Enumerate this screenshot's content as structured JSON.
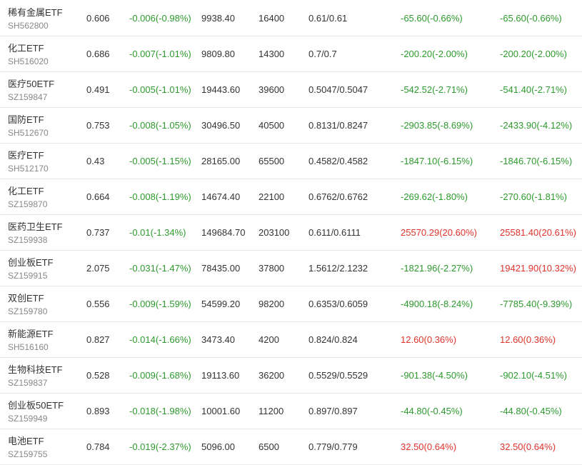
{
  "colors": {
    "down": "#2d9a2d",
    "up": "#e0332b",
    "text": "#333333",
    "code": "#888888",
    "divider": "#e8e8e8"
  },
  "rows": [
    {
      "name": "稀有金属ETF",
      "code": "SH562800",
      "price": "0.606",
      "change": "-0.006(-0.98%)",
      "change_dir": "down",
      "turnover": "9938.40",
      "volume": "16400",
      "range": "0.61/0.61",
      "flow1": "-65.60(-0.66%)",
      "flow1_dir": "down",
      "flow2": "-65.60(-0.66%)",
      "flow2_dir": "down"
    },
    {
      "name": "化工ETF",
      "code": "SH516020",
      "price": "0.686",
      "change": "-0.007(-1.01%)",
      "change_dir": "down",
      "turnover": "9809.80",
      "volume": "14300",
      "range": "0.7/0.7",
      "flow1": "-200.20(-2.00%)",
      "flow1_dir": "down",
      "flow2": "-200.20(-2.00%)",
      "flow2_dir": "down"
    },
    {
      "name": "医疗50ETF",
      "code": "SZ159847",
      "price": "0.491",
      "change": "-0.005(-1.01%)",
      "change_dir": "down",
      "turnover": "19443.60",
      "volume": "39600",
      "range": "0.5047/0.5047",
      "flow1": "-542.52(-2.71%)",
      "flow1_dir": "down",
      "flow2": "-541.40(-2.71%)",
      "flow2_dir": "down"
    },
    {
      "name": "国防ETF",
      "code": "SH512670",
      "price": "0.753",
      "change": "-0.008(-1.05%)",
      "change_dir": "down",
      "turnover": "30496.50",
      "volume": "40500",
      "range": "0.8131/0.8247",
      "flow1": "-2903.85(-8.69%)",
      "flow1_dir": "down",
      "flow2": "-2433.90(-4.12%)",
      "flow2_dir": "down"
    },
    {
      "name": "医疗ETF",
      "code": "SH512170",
      "price": "0.43",
      "change": "-0.005(-1.15%)",
      "change_dir": "down",
      "turnover": "28165.00",
      "volume": "65500",
      "range": "0.4582/0.4582",
      "flow1": "-1847.10(-6.15%)",
      "flow1_dir": "down",
      "flow2": "-1846.70(-6.15%)",
      "flow2_dir": "down"
    },
    {
      "name": "化工ETF",
      "code": "SZ159870",
      "price": "0.664",
      "change": "-0.008(-1.19%)",
      "change_dir": "down",
      "turnover": "14674.40",
      "volume": "22100",
      "range": "0.6762/0.6762",
      "flow1": "-269.62(-1.80%)",
      "flow1_dir": "down",
      "flow2": "-270.60(-1.81%)",
      "flow2_dir": "down"
    },
    {
      "name": "医药卫生ETF",
      "code": "SZ159938",
      "price": "0.737",
      "change": "-0.01(-1.34%)",
      "change_dir": "down",
      "turnover": "149684.70",
      "volume": "203100",
      "range": "0.611/0.6111",
      "flow1": "25570.29(20.60%)",
      "flow1_dir": "up",
      "flow2": "25581.40(20.61%)",
      "flow2_dir": "up"
    },
    {
      "name": "创业板ETF",
      "code": "SZ159915",
      "price": "2.075",
      "change": "-0.031(-1.47%)",
      "change_dir": "down",
      "turnover": "78435.00",
      "volume": "37800",
      "range": "1.5612/2.1232",
      "flow1": "-1821.96(-2.27%)",
      "flow1_dir": "down",
      "flow2": "19421.90(10.32%)",
      "flow2_dir": "up"
    },
    {
      "name": "双创ETF",
      "code": "SZ159780",
      "price": "0.556",
      "change": "-0.009(-1.59%)",
      "change_dir": "down",
      "turnover": "54599.20",
      "volume": "98200",
      "range": "0.6353/0.6059",
      "flow1": "-4900.18(-8.24%)",
      "flow1_dir": "down",
      "flow2": "-7785.40(-9.39%)",
      "flow2_dir": "down"
    },
    {
      "name": "新能源ETF",
      "code": "SH516160",
      "price": "0.827",
      "change": "-0.014(-1.66%)",
      "change_dir": "down",
      "turnover": "3473.40",
      "volume": "4200",
      "range": "0.824/0.824",
      "flow1": "12.60(0.36%)",
      "flow1_dir": "up",
      "flow2": "12.60(0.36%)",
      "flow2_dir": "up"
    },
    {
      "name": "生物科技ETF",
      "code": "SZ159837",
      "price": "0.528",
      "change": "-0.009(-1.68%)",
      "change_dir": "down",
      "turnover": "19113.60",
      "volume": "36200",
      "range": "0.5529/0.5529",
      "flow1": "-901.38(-4.50%)",
      "flow1_dir": "down",
      "flow2": "-902.10(-4.51%)",
      "flow2_dir": "down"
    },
    {
      "name": "创业板50ETF",
      "code": "SZ159949",
      "price": "0.893",
      "change": "-0.018(-1.98%)",
      "change_dir": "down",
      "turnover": "10001.60",
      "volume": "11200",
      "range": "0.897/0.897",
      "flow1": "-44.80(-0.45%)",
      "flow1_dir": "down",
      "flow2": "-44.80(-0.45%)",
      "flow2_dir": "down"
    },
    {
      "name": "电池ETF",
      "code": "SZ159755",
      "price": "0.784",
      "change": "-0.019(-2.37%)",
      "change_dir": "down",
      "turnover": "5096.00",
      "volume": "6500",
      "range": "0.779/0.779",
      "flow1": "32.50(0.64%)",
      "flow1_dir": "up",
      "flow2": "32.50(0.64%)",
      "flow2_dir": "up"
    }
  ]
}
